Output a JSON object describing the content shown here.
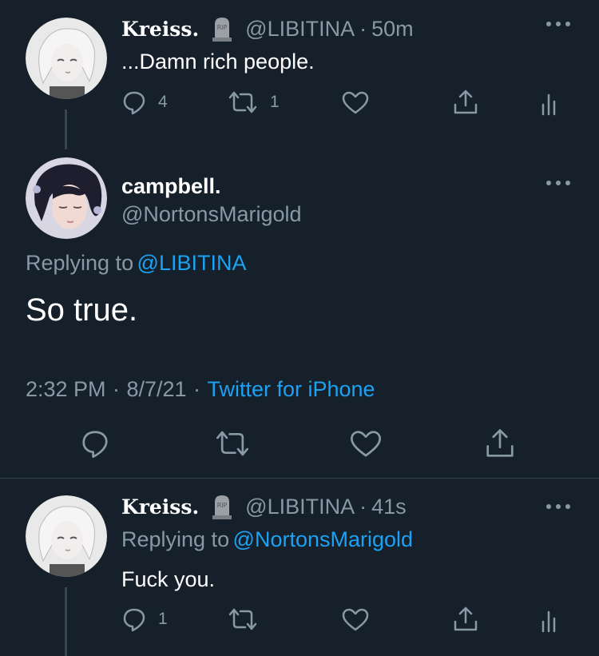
{
  "tweet1": {
    "display_name": "Kreiss.",
    "handle": "@LIBITINA",
    "separator": "·",
    "time": "50m",
    "text": "...Damn rich people.",
    "reply_count": "4",
    "retweet_count": "1"
  },
  "tweet2": {
    "display_name": "campbell.",
    "handle": "@NortonsMarigold",
    "replying_prefix": "Replying to",
    "replying_to": "@LIBITINA",
    "text": "So true.",
    "time": "2:32 PM",
    "sep1": "·",
    "date": "8/7/21",
    "sep2": "·",
    "source": "Twitter for iPhone"
  },
  "tweet3": {
    "display_name": "Kreiss.",
    "handle": "@LIBITINA",
    "separator": "·",
    "time": "41s",
    "replying_prefix": "Replying to",
    "replying_to": "@NortonsMarigold",
    "text": "Fuck you.",
    "reply_count": "1"
  },
  "colors": {
    "background": "#15202b",
    "muted": "#8899a6",
    "link": "#1da1f2",
    "divider": "#38444d"
  },
  "icons": [
    "more-icon",
    "reply-icon",
    "retweet-icon",
    "like-icon",
    "share-icon",
    "analytics-icon",
    "tombstone-emoji"
  ]
}
